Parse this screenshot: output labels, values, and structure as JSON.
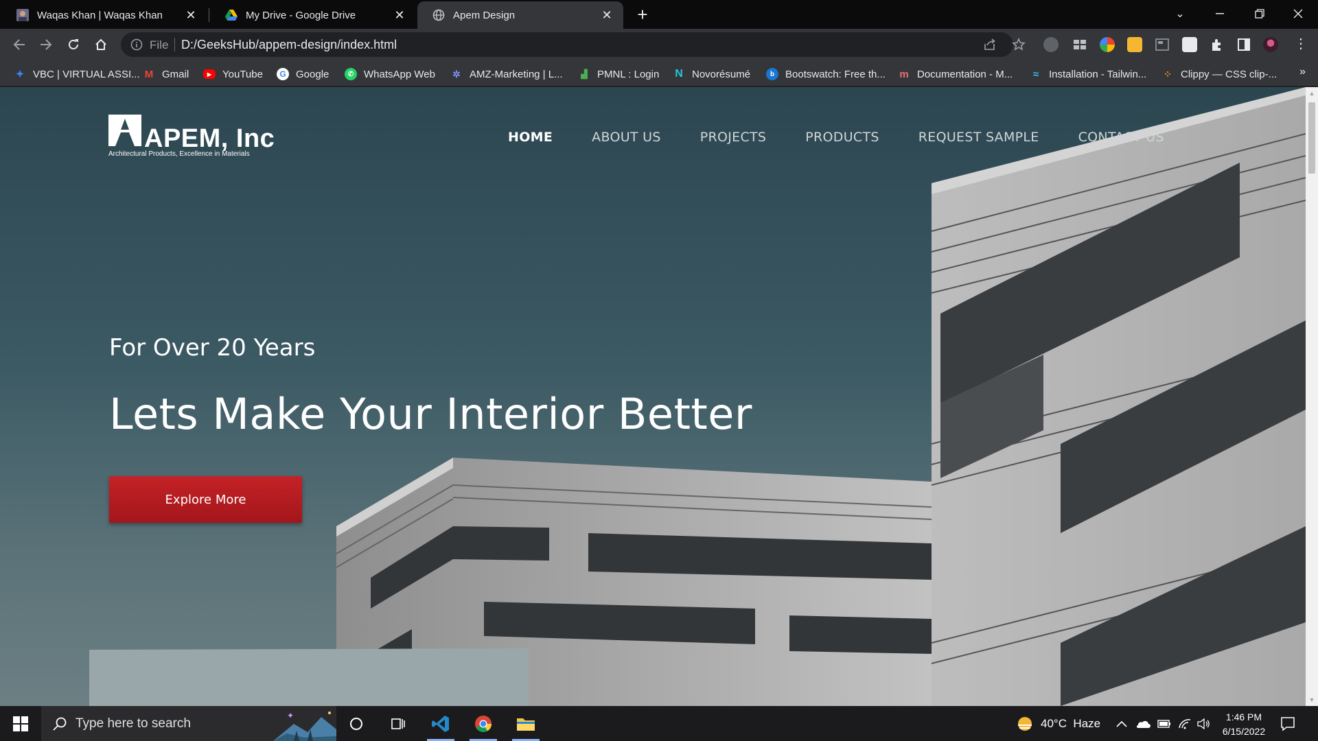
{
  "browser": {
    "tabs": [
      {
        "title": "Waqas Khan | Waqas Khan",
        "icon": "profile-photo-icon",
        "active": false
      },
      {
        "title": "My Drive - Google Drive",
        "icon": "google-drive-icon",
        "active": false
      },
      {
        "title": "Apem Design",
        "icon": "globe-icon",
        "active": true
      }
    ],
    "address": {
      "scheme_label": "File",
      "url": "D:/GeeksHub/appem-design/index.html"
    },
    "bookmarks": [
      {
        "label": "VBC | VIRTUAL ASSI...",
        "icon": "vbc-icon",
        "color": "#3b82f6"
      },
      {
        "label": "Gmail",
        "icon": "gmail-icon",
        "color": "#ea4335"
      },
      {
        "label": "YouTube",
        "icon": "youtube-icon",
        "color": "#ff0000"
      },
      {
        "label": "Google",
        "icon": "google-icon",
        "color": "#4285f4"
      },
      {
        "label": "WhatsApp Web",
        "icon": "whatsapp-icon",
        "color": "#25d366"
      },
      {
        "label": "AMZ-Marketing | L...",
        "icon": "amz-icon",
        "color": "#7c8cf0"
      },
      {
        "label": "PMNL : Login",
        "icon": "pmnl-icon",
        "color": "#4caf50"
      },
      {
        "label": "Novorésumé",
        "icon": "novoresume-icon",
        "color": "#26c6da"
      },
      {
        "label": "Bootswatch: Free th...",
        "icon": "bootswatch-icon",
        "color": "#1976d2"
      },
      {
        "label": "Documentation - M...",
        "icon": "materialize-icon",
        "color": "#ee6e73"
      },
      {
        "label": "Installation - Tailwin...",
        "icon": "tailwind-icon",
        "color": "#38bdf8"
      },
      {
        "label": "Clippy — CSS clip-...",
        "icon": "clippy-icon",
        "color": "#f59e0b"
      }
    ]
  },
  "site": {
    "logo_text": "APEM, Inc",
    "logo_tagline": "Architectural Products, Excellence in Materials",
    "nav": [
      {
        "label": "HOME",
        "active": true
      },
      {
        "label": "ABOUT US",
        "active": false
      },
      {
        "label": "PROJECTS",
        "active": false
      },
      {
        "label": "PRODUCTS",
        "active": false
      },
      {
        "label": "REQUEST SAMPLE",
        "active": false
      },
      {
        "label": "CONTACT US",
        "active": false
      }
    ],
    "hero": {
      "subtitle": "For Over 20 Years",
      "title": "Lets Make Your Interior Better",
      "cta": "Explore More"
    }
  },
  "taskbar": {
    "search_placeholder": "Type here to search",
    "weather": "40°C  Haze",
    "time": "1:46 PM",
    "date": "6/15/2022"
  }
}
